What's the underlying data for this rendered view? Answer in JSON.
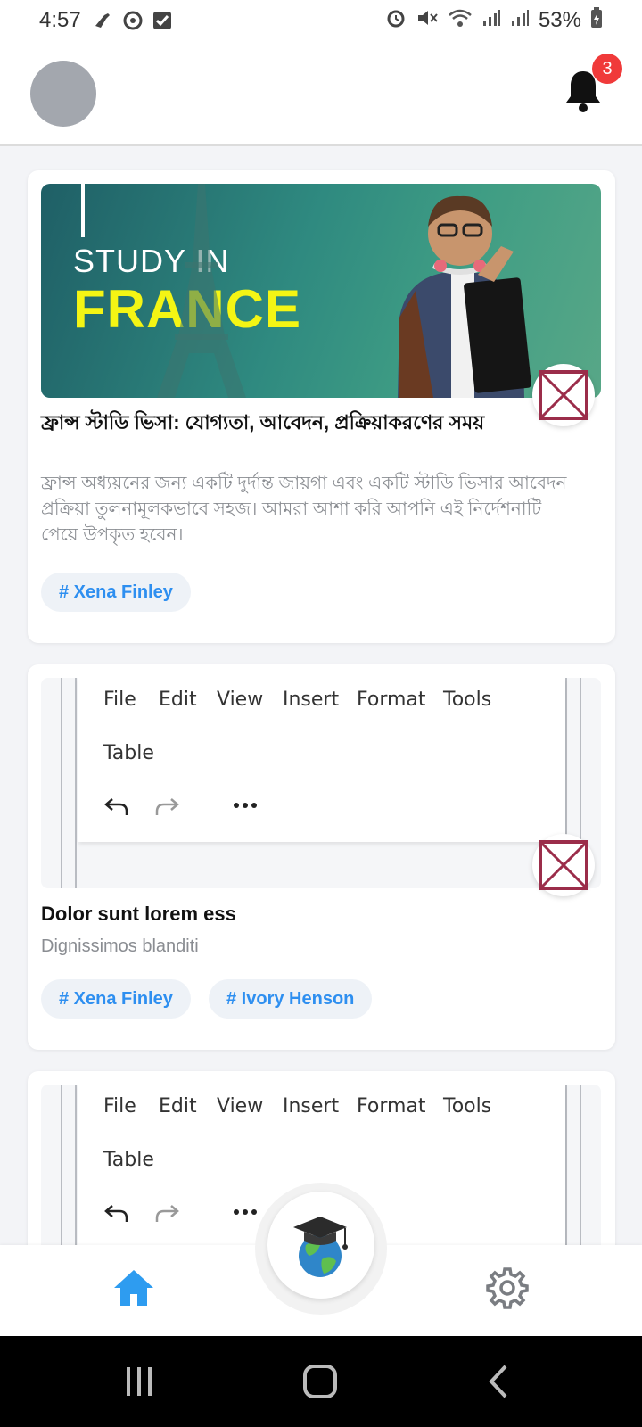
{
  "status_bar": {
    "time": "4:57",
    "battery": "53%",
    "icons": [
      "call-icon",
      "sync-icon",
      "check-square-icon",
      "alarm-icon",
      "mute-icon",
      "wifi-icon",
      "signal-icon",
      "signal-icon",
      "battery-charging-icon"
    ]
  },
  "header": {
    "notification_count": "3"
  },
  "posts": [
    {
      "banner": {
        "line1": "STUDY IN",
        "line2": "FRANCE"
      },
      "title": "ফ্রান্স স্টাডি ভিসা: যোগ্যতা, আবেদন, প্রক্রিয়াকরণের সময়",
      "description": "ফ্রান্স অধ্যয়নের জন্য একটি দুর্দান্ত জায়গা এবং একটি স্টাডি ভিসার আবেদন প্রক্রিয়া তুলনামূলকভাবে সহজ। আমরা আশা করি আপনি এই নির্দেশনাটি পেয়ে উপকৃত হবেন।",
      "tags": [
        "# Xena Finley"
      ]
    },
    {
      "editor_menu": [
        "File",
        "Edit",
        "View",
        "Insert",
        "Format",
        "Tools",
        "Table"
      ],
      "title": "Dolor sunt lorem ess",
      "description": "Dignissimos blanditi",
      "tags": [
        "# Xena Finley",
        "# Ivory Henson"
      ]
    },
    {
      "editor_menu": [
        "File",
        "Edit",
        "View",
        "Insert",
        "Format",
        "Tools",
        "Table"
      ]
    }
  ],
  "colors": {
    "accent": "#2e8ff0",
    "badge": "#f03a3a",
    "bookmark": "#9b2d4a",
    "banner_highlight": "#f4f514"
  }
}
